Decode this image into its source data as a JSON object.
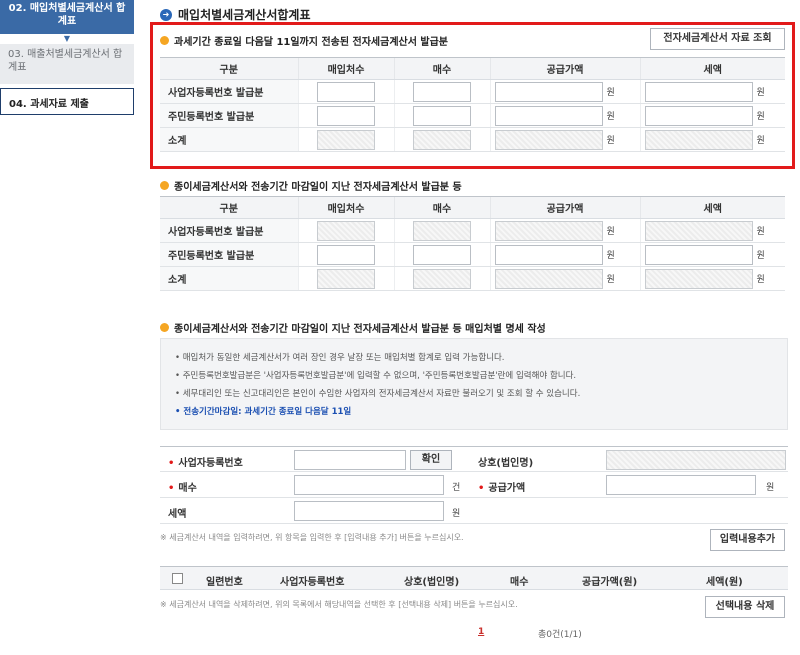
{
  "sidebar": {
    "items": [
      {
        "label": "02. 매입처별세금계산서 합계표",
        "state": "active"
      },
      {
        "label": "03. 매출처별세금계산서 합계표",
        "state": "inactive"
      },
      {
        "label": "04. 과세자료 제출",
        "state": "inactive"
      }
    ]
  },
  "page_title": "매입처별세금계산서합계표",
  "section1": {
    "title": "과세기간 종료일 다음달 11일까지 전송된 전자세금계산서 발급분",
    "lookup_button": "전자세금계산서 자료 조회",
    "columns": [
      "구분",
      "매입처수",
      "매수",
      "공급가액",
      "세액"
    ],
    "rows": [
      "사업자등록번호 발급분",
      "주민등록번호 발급분",
      "소계"
    ],
    "unit": "원"
  },
  "section2": {
    "title": "종이세금계산서와 전송기간 마감일이 지난 전자세금계산서 발급분 등",
    "columns": [
      "구분",
      "매입처수",
      "매수",
      "공급가액",
      "세액"
    ],
    "rows": [
      "사업자등록번호 발급분",
      "주민등록번호 발급분",
      "소계"
    ],
    "unit": "원"
  },
  "section3": {
    "title": "종이세금계산서와 전송기간 마감일이 지난 전자세금계산서 발급분 등 매입처별 명세 작성",
    "notes": [
      "• 매입처가 동일한 세금계산서가 여러 장인 경우 날장 또는 매입처별 합계로 입력 가능합니다.",
      "• 주민등록번호발급분은 '사업자등록번호발급분'에 입력할 수 없으며, '주민등록번호발급분'란에 입력해야 합니다.",
      "• 세무대리인 또는 신고대리인은 본인이 수임한 사업자의 전자세금계산서 자료만 불러오기 및 조회 할 수 있습니다."
    ],
    "deadline_note": "• 전송기간마감일: 과세기간 종료일 다음달 11일"
  },
  "form": {
    "biz_no_label": "사업자등록번호",
    "confirm_button": "확인",
    "company_label": "상호(법인명)",
    "count_label": "매수",
    "count_unit": "건",
    "supply_label": "공급가액",
    "supply_unit": "원",
    "tax_label": "세액",
    "tax_unit": "원",
    "add_helper": "※ 세금계산서 내역을 입력하려면, 위 항목을 입력한 후 [입력내용 추가] 버튼을 누르십시오.",
    "add_button": "입력내용추가"
  },
  "list": {
    "columns": [
      "일련번호",
      "사업자등록번호",
      "상호(법인명)",
      "매수",
      "공급가액(원)",
      "세액(원)"
    ],
    "delete_helper": "※ 세금계산서 내역을 삭제하려면, 위의 목록에서 해당내역을 선택한 후 [선택내용 삭제] 버튼을 누르십시오.",
    "delete_button": "선택내용 삭제"
  },
  "pagination": {
    "current_page": "1",
    "total_text": "총0건(1/1)"
  },
  "colors": {
    "accent": "#3a6aa6",
    "highlight_border": "#e21a1a",
    "bullet": "#f5a623"
  }
}
